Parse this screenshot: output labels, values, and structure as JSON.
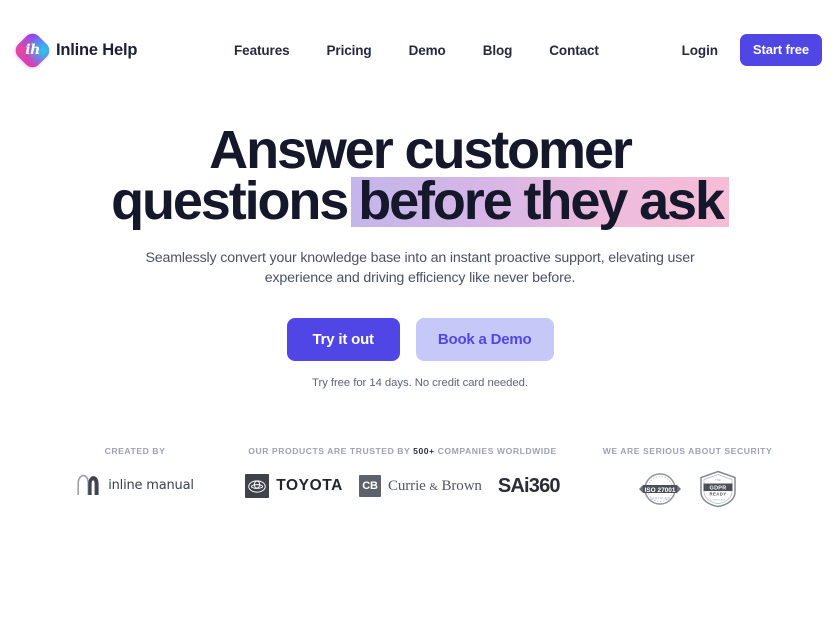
{
  "brand": {
    "name": "Inline Help",
    "logo_glyph": "ih",
    "logo_icon": "inline-help-diamond-logo",
    "gradient_from": "#9d3bf5",
    "gradient_to": "#ef3f92"
  },
  "nav": {
    "items": [
      {
        "label": "Features"
      },
      {
        "label": "Pricing"
      },
      {
        "label": "Demo"
      },
      {
        "label": "Blog"
      },
      {
        "label": "Contact"
      }
    ],
    "login_label": "Login",
    "start_free_label": "Start free",
    "start_free_color": "#5046e4"
  },
  "hero": {
    "headline_line1": "Answer customer",
    "headline_line2_plain": "questions",
    "headline_line2_highlight": "before they ask",
    "highlight_gradient_from": "#c2b6ea",
    "highlight_gradient_to": "#f6bdd6",
    "subtitle": "Seamlessly convert your knowledge base into an instant proactive support, elevating user experience and driving efficiency like never before.",
    "primary_cta": "Try it out",
    "secondary_cta": "Book a Demo",
    "primary_cta_color": "#4f46e5",
    "secondary_cta_bg": "#c6c9f8",
    "cta_note": "Try free for 14 days. No credit card needed."
  },
  "proof": {
    "created": {
      "label": "CREATED BY",
      "logo_name": "inline manual",
      "logo_icon": "inline-manual-m-icon"
    },
    "trusted": {
      "label_before": "OUR PRODUCTS ARE TRUSTED BY",
      "label_strong": "500+",
      "label_after": "COMPANIES WORLDWIDE",
      "logos": [
        {
          "name": "TOYOTA",
          "icon": "toyota-emblem-icon"
        },
        {
          "name": "Currie",
          "suffix": "Brown",
          "amp": "&",
          "icon": "currie-brown-cb-icon"
        },
        {
          "name": "SAi360",
          "icon": "sai360-wordmark-icon"
        }
      ]
    },
    "security": {
      "label": "WE ARE SERIOUS ABOUT SECURITY",
      "badges": [
        {
          "name": "ISO 27001",
          "icon": "iso-27001-seal-icon",
          "sub": "CERTIFIED"
        },
        {
          "name": "GDPR",
          "name2": "READY",
          "icon": "gdpr-ready-shield-icon"
        }
      ]
    }
  }
}
